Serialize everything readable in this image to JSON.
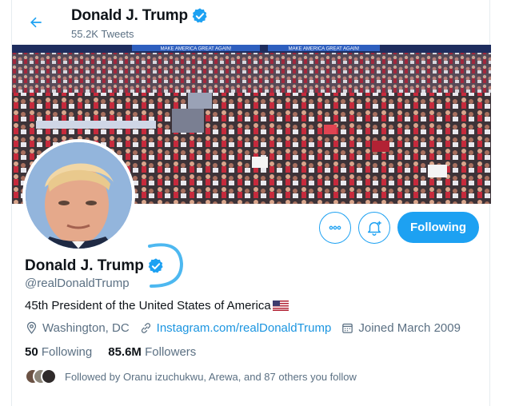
{
  "header": {
    "name": "Donald J. Trump",
    "tweet_count": "55.2K Tweets"
  },
  "banner": {
    "sign_text_1": "MAKE AMERICA GREAT AGAIN!",
    "sign_text_2": "MAKE AMERICA GREAT AGAIN!"
  },
  "actions": {
    "following_label": "Following"
  },
  "profile": {
    "name": "Donald J. Trump",
    "handle": "@realDonaldTrump",
    "bio": "45th President of the United States of America",
    "location": "Washington, DC",
    "website": "Instagram.com/realDonaldTrump",
    "joined": "Joined March 2009"
  },
  "stats": {
    "following_count": "50",
    "following_label": "Following",
    "followers_count": "85.6M",
    "followers_label": "Followers"
  },
  "followed_by": {
    "text": "Followed by Oranu izuchukwu, Arewa, and 87 others you follow"
  },
  "colors": {
    "accent": "#1da1f2",
    "verified": "#1da1f2",
    "annotation": "#4db8f0"
  },
  "icons": [
    "back-arrow-icon",
    "verified-badge-icon",
    "more-options-icon",
    "notification-bell-icon",
    "location-pin-icon",
    "link-icon",
    "calendar-icon",
    "us-flag-icon"
  ]
}
